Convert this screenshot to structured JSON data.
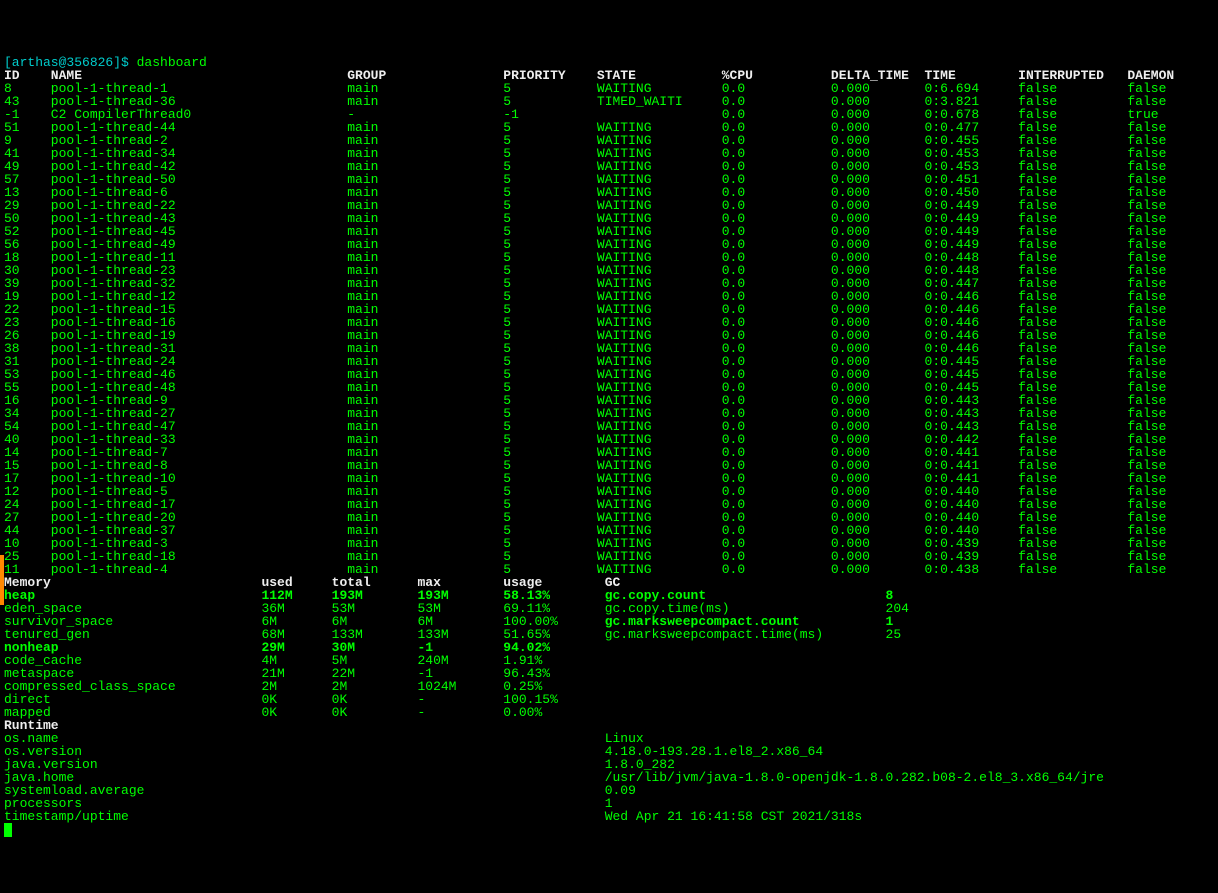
{
  "prompt": {
    "user": "arthas",
    "host": "356826",
    "command": "dashboard"
  },
  "headers": [
    "ID",
    "NAME",
    "GROUP",
    "PRIORITY",
    "STATE",
    "%CPU",
    "DELTA_TIME",
    "TIME",
    "INTERRUPTED",
    "DAEMON"
  ],
  "threads": [
    {
      "id": "8",
      "name": "pool-1-thread-1",
      "group": "main",
      "priority": "5",
      "state": "WAITING",
      "cpu": "0.0",
      "delta": "0.000",
      "time": "0:6.694",
      "intr": "false",
      "daemon": "false"
    },
    {
      "id": "43",
      "name": "pool-1-thread-36",
      "group": "main",
      "priority": "5",
      "state": "TIMED_WAITI",
      "cpu": "0.0",
      "delta": "0.000",
      "time": "0:3.821",
      "intr": "false",
      "daemon": "false"
    },
    {
      "id": "-1",
      "name": "C2 CompilerThread0",
      "group": "-",
      "priority": "-1",
      "state": "",
      "cpu": "0.0",
      "delta": "0.000",
      "time": "0:0.678",
      "intr": "false",
      "daemon": "true"
    },
    {
      "id": "51",
      "name": "pool-1-thread-44",
      "group": "main",
      "priority": "5",
      "state": "WAITING",
      "cpu": "0.0",
      "delta": "0.000",
      "time": "0:0.477",
      "intr": "false",
      "daemon": "false"
    },
    {
      "id": "9",
      "name": "pool-1-thread-2",
      "group": "main",
      "priority": "5",
      "state": "WAITING",
      "cpu": "0.0",
      "delta": "0.000",
      "time": "0:0.455",
      "intr": "false",
      "daemon": "false"
    },
    {
      "id": "41",
      "name": "pool-1-thread-34",
      "group": "main",
      "priority": "5",
      "state": "WAITING",
      "cpu": "0.0",
      "delta": "0.000",
      "time": "0:0.453",
      "intr": "false",
      "daemon": "false"
    },
    {
      "id": "49",
      "name": "pool-1-thread-42",
      "group": "main",
      "priority": "5",
      "state": "WAITING",
      "cpu": "0.0",
      "delta": "0.000",
      "time": "0:0.453",
      "intr": "false",
      "daemon": "false"
    },
    {
      "id": "57",
      "name": "pool-1-thread-50",
      "group": "main",
      "priority": "5",
      "state": "WAITING",
      "cpu": "0.0",
      "delta": "0.000",
      "time": "0:0.451",
      "intr": "false",
      "daemon": "false"
    },
    {
      "id": "13",
      "name": "pool-1-thread-6",
      "group": "main",
      "priority": "5",
      "state": "WAITING",
      "cpu": "0.0",
      "delta": "0.000",
      "time": "0:0.450",
      "intr": "false",
      "daemon": "false"
    },
    {
      "id": "29",
      "name": "pool-1-thread-22",
      "group": "main",
      "priority": "5",
      "state": "WAITING",
      "cpu": "0.0",
      "delta": "0.000",
      "time": "0:0.449",
      "intr": "false",
      "daemon": "false"
    },
    {
      "id": "50",
      "name": "pool-1-thread-43",
      "group": "main",
      "priority": "5",
      "state": "WAITING",
      "cpu": "0.0",
      "delta": "0.000",
      "time": "0:0.449",
      "intr": "false",
      "daemon": "false"
    },
    {
      "id": "52",
      "name": "pool-1-thread-45",
      "group": "main",
      "priority": "5",
      "state": "WAITING",
      "cpu": "0.0",
      "delta": "0.000",
      "time": "0:0.449",
      "intr": "false",
      "daemon": "false"
    },
    {
      "id": "56",
      "name": "pool-1-thread-49",
      "group": "main",
      "priority": "5",
      "state": "WAITING",
      "cpu": "0.0",
      "delta": "0.000",
      "time": "0:0.449",
      "intr": "false",
      "daemon": "false"
    },
    {
      "id": "18",
      "name": "pool-1-thread-11",
      "group": "main",
      "priority": "5",
      "state": "WAITING",
      "cpu": "0.0",
      "delta": "0.000",
      "time": "0:0.448",
      "intr": "false",
      "daemon": "false"
    },
    {
      "id": "30",
      "name": "pool-1-thread-23",
      "group": "main",
      "priority": "5",
      "state": "WAITING",
      "cpu": "0.0",
      "delta": "0.000",
      "time": "0:0.448",
      "intr": "false",
      "daemon": "false"
    },
    {
      "id": "39",
      "name": "pool-1-thread-32",
      "group": "main",
      "priority": "5",
      "state": "WAITING",
      "cpu": "0.0",
      "delta": "0.000",
      "time": "0:0.447",
      "intr": "false",
      "daemon": "false"
    },
    {
      "id": "19",
      "name": "pool-1-thread-12",
      "group": "main",
      "priority": "5",
      "state": "WAITING",
      "cpu": "0.0",
      "delta": "0.000",
      "time": "0:0.446",
      "intr": "false",
      "daemon": "false"
    },
    {
      "id": "22",
      "name": "pool-1-thread-15",
      "group": "main",
      "priority": "5",
      "state": "WAITING",
      "cpu": "0.0",
      "delta": "0.000",
      "time": "0:0.446",
      "intr": "false",
      "daemon": "false"
    },
    {
      "id": "23",
      "name": "pool-1-thread-16",
      "group": "main",
      "priority": "5",
      "state": "WAITING",
      "cpu": "0.0",
      "delta": "0.000",
      "time": "0:0.446",
      "intr": "false",
      "daemon": "false"
    },
    {
      "id": "26",
      "name": "pool-1-thread-19",
      "group": "main",
      "priority": "5",
      "state": "WAITING",
      "cpu": "0.0",
      "delta": "0.000",
      "time": "0:0.446",
      "intr": "false",
      "daemon": "false"
    },
    {
      "id": "38",
      "name": "pool-1-thread-31",
      "group": "main",
      "priority": "5",
      "state": "WAITING",
      "cpu": "0.0",
      "delta": "0.000",
      "time": "0:0.446",
      "intr": "false",
      "daemon": "false"
    },
    {
      "id": "31",
      "name": "pool-1-thread-24",
      "group": "main",
      "priority": "5",
      "state": "WAITING",
      "cpu": "0.0",
      "delta": "0.000",
      "time": "0:0.445",
      "intr": "false",
      "daemon": "false"
    },
    {
      "id": "53",
      "name": "pool-1-thread-46",
      "group": "main",
      "priority": "5",
      "state": "WAITING",
      "cpu": "0.0",
      "delta": "0.000",
      "time": "0:0.445",
      "intr": "false",
      "daemon": "false"
    },
    {
      "id": "55",
      "name": "pool-1-thread-48",
      "group": "main",
      "priority": "5",
      "state": "WAITING",
      "cpu": "0.0",
      "delta": "0.000",
      "time": "0:0.445",
      "intr": "false",
      "daemon": "false"
    },
    {
      "id": "16",
      "name": "pool-1-thread-9",
      "group": "main",
      "priority": "5",
      "state": "WAITING",
      "cpu": "0.0",
      "delta": "0.000",
      "time": "0:0.443",
      "intr": "false",
      "daemon": "false"
    },
    {
      "id": "34",
      "name": "pool-1-thread-27",
      "group": "main",
      "priority": "5",
      "state": "WAITING",
      "cpu": "0.0",
      "delta": "0.000",
      "time": "0:0.443",
      "intr": "false",
      "daemon": "false"
    },
    {
      "id": "54",
      "name": "pool-1-thread-47",
      "group": "main",
      "priority": "5",
      "state": "WAITING",
      "cpu": "0.0",
      "delta": "0.000",
      "time": "0:0.443",
      "intr": "false",
      "daemon": "false"
    },
    {
      "id": "40",
      "name": "pool-1-thread-33",
      "group": "main",
      "priority": "5",
      "state": "WAITING",
      "cpu": "0.0",
      "delta": "0.000",
      "time": "0:0.442",
      "intr": "false",
      "daemon": "false"
    },
    {
      "id": "14",
      "name": "pool-1-thread-7",
      "group": "main",
      "priority": "5",
      "state": "WAITING",
      "cpu": "0.0",
      "delta": "0.000",
      "time": "0:0.441",
      "intr": "false",
      "daemon": "false"
    },
    {
      "id": "15",
      "name": "pool-1-thread-8",
      "group": "main",
      "priority": "5",
      "state": "WAITING",
      "cpu": "0.0",
      "delta": "0.000",
      "time": "0:0.441",
      "intr": "false",
      "daemon": "false"
    },
    {
      "id": "17",
      "name": "pool-1-thread-10",
      "group": "main",
      "priority": "5",
      "state": "WAITING",
      "cpu": "0.0",
      "delta": "0.000",
      "time": "0:0.441",
      "intr": "false",
      "daemon": "false"
    },
    {
      "id": "12",
      "name": "pool-1-thread-5",
      "group": "main",
      "priority": "5",
      "state": "WAITING",
      "cpu": "0.0",
      "delta": "0.000",
      "time": "0:0.440",
      "intr": "false",
      "daemon": "false"
    },
    {
      "id": "24",
      "name": "pool-1-thread-17",
      "group": "main",
      "priority": "5",
      "state": "WAITING",
      "cpu": "0.0",
      "delta": "0.000",
      "time": "0:0.440",
      "intr": "false",
      "daemon": "false"
    },
    {
      "id": "27",
      "name": "pool-1-thread-20",
      "group": "main",
      "priority": "5",
      "state": "WAITING",
      "cpu": "0.0",
      "delta": "0.000",
      "time": "0:0.440",
      "intr": "false",
      "daemon": "false"
    },
    {
      "id": "44",
      "name": "pool-1-thread-37",
      "group": "main",
      "priority": "5",
      "state": "WAITING",
      "cpu": "0.0",
      "delta": "0.000",
      "time": "0:0.440",
      "intr": "false",
      "daemon": "false"
    },
    {
      "id": "10",
      "name": "pool-1-thread-3",
      "group": "main",
      "priority": "5",
      "state": "WAITING",
      "cpu": "0.0",
      "delta": "0.000",
      "time": "0:0.439",
      "intr": "false",
      "daemon": "false"
    },
    {
      "id": "25",
      "name": "pool-1-thread-18",
      "group": "main",
      "priority": "5",
      "state": "WAITING",
      "cpu": "0.0",
      "delta": "0.000",
      "time": "0:0.439",
      "intr": "false",
      "daemon": "false"
    },
    {
      "id": "11",
      "name": "pool-1-thread-4",
      "group": "main",
      "priority": "5",
      "state": "WAITING",
      "cpu": "0.0",
      "delta": "0.000",
      "time": "0:0.438",
      "intr": "false",
      "daemon": "false"
    }
  ],
  "memory": {
    "headers": [
      "Memory",
      "used",
      "total",
      "max",
      "usage"
    ],
    "rows": [
      {
        "name": "heap",
        "used": "112M",
        "total": "193M",
        "max": "193M",
        "usage": "58.13%",
        "bold": true
      },
      {
        "name": "eden_space",
        "used": "36M",
        "total": "53M",
        "max": "53M",
        "usage": "69.11%"
      },
      {
        "name": "survivor_space",
        "used": "6M",
        "total": "6M",
        "max": "6M",
        "usage": "100.00%"
      },
      {
        "name": "tenured_gen",
        "used": "68M",
        "total": "133M",
        "max": "133M",
        "usage": "51.65%"
      },
      {
        "name": "nonheap",
        "used": "29M",
        "total": "30M",
        "max": "-1",
        "usage": "94.02%",
        "bold": true
      },
      {
        "name": "code_cache",
        "used": "4M",
        "total": "5M",
        "max": "240M",
        "usage": "1.91%"
      },
      {
        "name": "metaspace",
        "used": "21M",
        "total": "22M",
        "max": "-1",
        "usage": "96.43%"
      },
      {
        "name": "compressed_class_space",
        "used": "2M",
        "total": "2M",
        "max": "1024M",
        "usage": "0.25%"
      },
      {
        "name": "direct",
        "used": "0K",
        "total": "0K",
        "max": "-",
        "usage": "100.15%"
      },
      {
        "name": "mapped",
        "used": "0K",
        "total": "0K",
        "max": "-",
        "usage": "0.00%"
      }
    ]
  },
  "gc": {
    "header": "GC",
    "rows": [
      {
        "name": "gc.copy.count",
        "value": "8",
        "bold": true
      },
      {
        "name": "gc.copy.time(ms)",
        "value": "204"
      },
      {
        "name": "gc.marksweepcompact.count",
        "value": "1",
        "bold": true
      },
      {
        "name": "gc.marksweepcompact.time(ms)",
        "value": "25"
      }
    ]
  },
  "runtime": {
    "header": "Runtime",
    "rows": [
      {
        "name": "os.name",
        "value": "Linux"
      },
      {
        "name": "os.version",
        "value": "4.18.0-193.28.1.el8_2.x86_64"
      },
      {
        "name": "java.version",
        "value": "1.8.0_282"
      },
      {
        "name": "java.home",
        "value": "/usr/lib/jvm/java-1.8.0-openjdk-1.8.0.282.b08-2.el8_3.x86_64/jre"
      },
      {
        "name": "systemload.average",
        "value": "0.09"
      },
      {
        "name": "processors",
        "value": "1"
      },
      {
        "name": "timestamp/uptime",
        "value": "Wed Apr 21 16:41:58 CST 2021/318s"
      }
    ]
  }
}
